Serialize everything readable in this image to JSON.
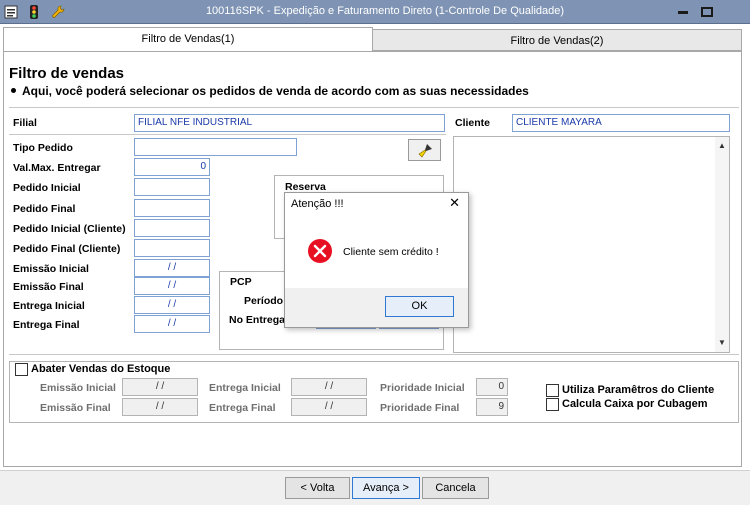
{
  "window": {
    "title": "100116SPK - Expedição e Faturamento Direto (1-Controle De Qualidade)",
    "bar_color": "#7f94b4"
  },
  "tabs": [
    {
      "label": "Filtro de Vendas(1)",
      "active": true
    },
    {
      "label": "Filtro de Vendas(2)",
      "active": false
    }
  ],
  "header": {
    "title": "Filtro de vendas",
    "subtitle": "Aqui, você poderá selecionar os pedidos de venda de acordo com as suas necessidades"
  },
  "filial": {
    "label": "Filial",
    "value": "FILIAL NFE INDUSTRIAL"
  },
  "cliente": {
    "label": "Cliente",
    "value": "CLIENTE MAYARA"
  },
  "fields": {
    "tipo_pedido": {
      "label": "Tipo Pedido",
      "value": ""
    },
    "val_max": {
      "label": "Val.Max. Entregar",
      "value": "0"
    },
    "pedido_inicial": {
      "label": "Pedido Inicial",
      "value": ""
    },
    "pedido_final": {
      "label": "Pedido Final",
      "value": ""
    },
    "pedido_inicial_cliente": {
      "label": "Pedido Inicial (Cliente)",
      "value": ""
    },
    "pedido_final_cliente": {
      "label": "Pedido Final (Cliente)",
      "value": ""
    },
    "emissao_inicial": {
      "label": "Emissão Inicial",
      "value": "/ /"
    },
    "emissao_final": {
      "label": "Emissão Final",
      "value": "/ /"
    },
    "entrega_inicial": {
      "label": "Entrega Inicial",
      "value": "/ /"
    },
    "entrega_final": {
      "label": "Entrega Final",
      "value": "/ /"
    }
  },
  "reserva": {
    "label": "Reserva"
  },
  "pcp": {
    "label": "PCP",
    "periodo": "Período",
    "no_entrega": "No Entrega"
  },
  "estoque": {
    "label": "Abater Vendas do Estoque",
    "checked": false,
    "emissao_inicial": {
      "label": "Emissão Inicial",
      "value": "/ /"
    },
    "emissao_final": {
      "label": "Emissão Final",
      "value": "/ /"
    },
    "entrega_inicial": {
      "label": "Entrega Inicial",
      "value": "/ /"
    },
    "entrega_final": {
      "label": "Entrega Final",
      "value": "/ /"
    },
    "prioridade_inicial": {
      "label": "Prioridade Inicial",
      "value": "0"
    },
    "prioridade_final": {
      "label": "Prioridade Final",
      "value": "9"
    }
  },
  "options": {
    "utiliza_parametros": {
      "label": "Utiliza Paramêtros do Cliente",
      "checked": false
    },
    "calcula_caixa": {
      "label": "Calcula Caixa por Cubagem",
      "checked": false
    }
  },
  "footer": {
    "back": "< Volta",
    "next": "Avança >",
    "cancel": "Cancela"
  },
  "dialog": {
    "title": "Atenção !!!",
    "message": "Cliente sem crédito !",
    "ok": "OK",
    "icon": "error-icon",
    "icon_color": "#e81123"
  }
}
